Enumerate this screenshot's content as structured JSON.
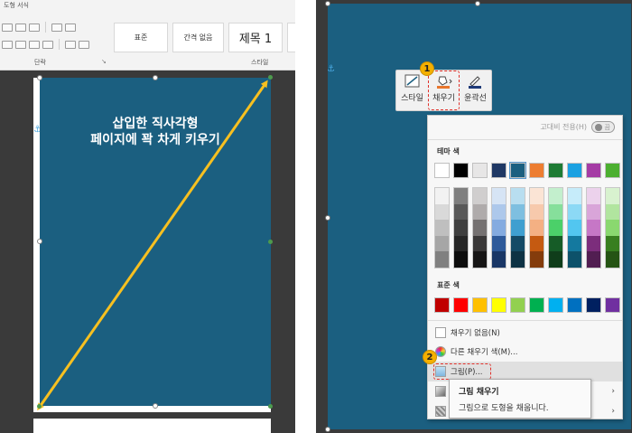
{
  "left_pane": {
    "ribbon": {
      "tab_title": "도형 서식",
      "paragraph_group_label": "단락",
      "styles_group_label": "스타일",
      "style_gallery": [
        "표준",
        "간격 없음",
        "제목 1"
      ]
    },
    "rect_text_line1": "삽입한 직사각형",
    "rect_text_line2": "페이지에 꽉 차게 키우기",
    "anchor_symbol": "⚓"
  },
  "right_pane": {
    "anchor_symbol": "⚓",
    "mini_toolbar": {
      "style_label": "스타일",
      "fill_label": "채우기",
      "outline_label": "윤곽선"
    },
    "step_badges": [
      "1",
      "2"
    ],
    "dropdown": {
      "high_contrast_label": "고대비 전용(H)",
      "toggle_label": "끔",
      "theme_colors_label": "테마 색",
      "standard_colors_label": "표준 색",
      "no_fill_label": "채우기 없음(N)",
      "more_colors_label": "다른 채우기 색(M)...",
      "picture_label": "그림(P)...",
      "submenu_chevron": "›",
      "theme_colors": [
        "#ffffff",
        "#000000",
        "#e7e6e6",
        "#1f3864",
        "#1b5f80",
        "#ed7d31",
        "#1e7b34",
        "#1ba1e2",
        "#a53ca5",
        "#4caf30"
      ],
      "standard_colors": [
        "#c00000",
        "#ff0000",
        "#ffc000",
        "#ffff00",
        "#92d050",
        "#00b050",
        "#00b0f0",
        "#0070c0",
        "#002060",
        "#7030a0"
      ],
      "shade_columns": [
        [
          "#f2f2f2",
          "#d9d9d9",
          "#bfbfbf",
          "#a6a6a6",
          "#808080"
        ],
        [
          "#7f7f7f",
          "#595959",
          "#3f3f3f",
          "#262626",
          "#0d0d0d"
        ],
        [
          "#d0cece",
          "#afabab",
          "#757171",
          "#3a3838",
          "#171616"
        ],
        [
          "#d6e4f5",
          "#adc8eb",
          "#84abe0",
          "#2e5a9a",
          "#1a3766"
        ],
        [
          "#b8def0",
          "#7ebfe0",
          "#3f9fd0",
          "#144a66",
          "#0d3244"
        ],
        [
          "#fbe4d5",
          "#f7c9ac",
          "#f4b083",
          "#c55a11",
          "#843c0c"
        ],
        [
          "#c3efcd",
          "#86df9b",
          "#4bd069",
          "#165c27",
          "#0f3d1a"
        ],
        [
          "#c6ecfa",
          "#8cd9f5",
          "#52c6f0",
          "#14799f",
          "#0d516a"
        ],
        [
          "#ecd2ec",
          "#d9a5d9",
          "#c677c6",
          "#7c2d7c",
          "#521e52"
        ],
        [
          "#d8f2cf",
          "#b1e59f",
          "#8ad86f",
          "#387f1f",
          "#255414"
        ]
      ]
    },
    "tooltip": {
      "title": "그림 채우기",
      "description": "그림으로 도형을 채웁니다."
    }
  }
}
